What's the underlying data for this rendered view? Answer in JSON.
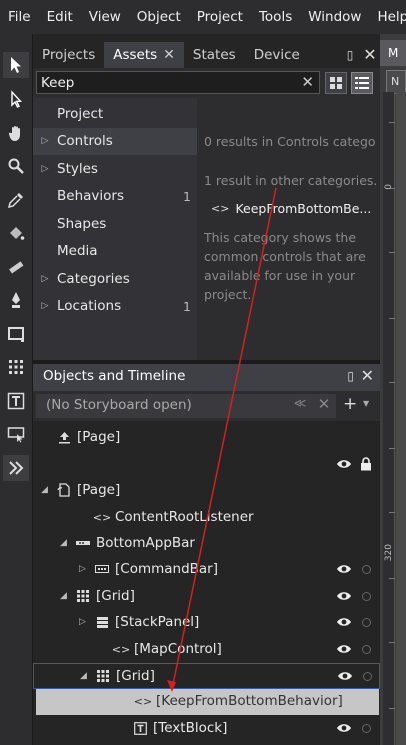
{
  "menu": [
    "File",
    "Edit",
    "View",
    "Object",
    "Project",
    "Tools",
    "Window",
    "Help"
  ],
  "assets_panel": {
    "tabs": [
      {
        "label": "Projects",
        "active": false
      },
      {
        "label": "Assets",
        "active": true,
        "closable": true
      },
      {
        "label": "States",
        "active": false
      },
      {
        "label": "Device",
        "active": false
      }
    ],
    "search_value": "Keep",
    "categories": [
      {
        "label": "Project",
        "expandable": false,
        "count": ""
      },
      {
        "label": "Controls",
        "expandable": true,
        "count": "",
        "selected": true
      },
      {
        "label": "Styles",
        "expandable": true,
        "count": ""
      },
      {
        "label": "Behaviors",
        "expandable": false,
        "count": "1"
      },
      {
        "label": "Shapes",
        "expandable": false,
        "count": ""
      },
      {
        "label": "Media",
        "expandable": false,
        "count": ""
      },
      {
        "label": "Categories",
        "expandable": true,
        "count": ""
      },
      {
        "label": "Locations",
        "expandable": true,
        "count": "1"
      }
    ],
    "results_heading": "0 results in Controls catego",
    "other_heading": "1 result in other categories.",
    "result_item": "KeepFromBottomBe...",
    "description": "This category shows the common controls that are available for use in your project."
  },
  "objects_panel": {
    "title": "Objects and Timeline",
    "storyboard": "(No Storyboard open)",
    "tree": [
      {
        "label": "[Page]",
        "indent": 0,
        "twisty": "",
        "icon": "up-arrow-icon",
        "eye": false
      },
      {
        "label": "",
        "indent": 0,
        "twisty": "",
        "icon": "",
        "eye": true,
        "lock": true
      },
      {
        "label": "[Page]",
        "indent": 0,
        "twisty": "down",
        "icon": "page-icon",
        "eye": false
      },
      {
        "label": "ContentRootListener",
        "indent": 2,
        "twisty": "",
        "icon": "code-icon",
        "eye": false
      },
      {
        "label": "BottomAppBar",
        "indent": 1,
        "twisty": "down",
        "icon": "appbar-icon",
        "eye": false
      },
      {
        "label": "[CommandBar]",
        "indent": 2,
        "twisty": "right",
        "icon": "commandbar-icon",
        "eye": true
      },
      {
        "label": "[Grid]",
        "indent": 1,
        "twisty": "down",
        "icon": "grid-icon",
        "eye": true
      },
      {
        "label": "[StackPanel]",
        "indent": 2,
        "twisty": "right",
        "icon": "stackpanel-icon",
        "eye": true
      },
      {
        "label": "[MapControl]",
        "indent": 3,
        "twisty": "",
        "icon": "code-icon",
        "eye": true
      },
      {
        "label": "[Grid]",
        "indent": 2,
        "twisty": "down",
        "icon": "grid-icon",
        "eye": true,
        "outlined": true
      },
      {
        "label": "[KeepFromBottomBehavior]",
        "indent": 4,
        "twisty": "",
        "icon": "code-icon",
        "eye": false,
        "dragging": true
      },
      {
        "label": "[TextBlock]",
        "indent": 4,
        "twisty": "",
        "icon": "textblock-icon",
        "eye": true
      }
    ]
  },
  "artboard": {
    "doc_tab": "M",
    "chip": "N",
    "ruler_labels": [
      "0",
      "320"
    ]
  },
  "colors": {
    "drag_arrow": "#d42020",
    "accent_outline": "#3a5a9c"
  }
}
